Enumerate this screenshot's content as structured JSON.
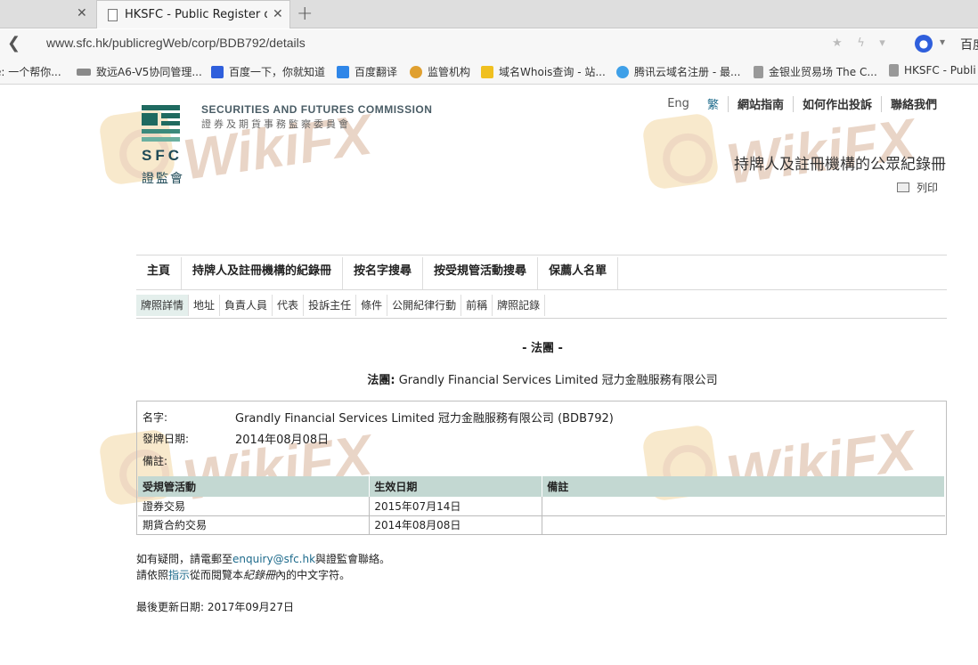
{
  "browser": {
    "tabs": [
      {
        "title": "",
        "active": false
      },
      {
        "title": "HKSFC - Public Register of L",
        "active": true
      }
    ],
    "url": "www.sfc.hk/publicregWeb/corp/BDB792/details",
    "search_engine_label": "百度",
    "bookmarks": [
      {
        "label": "e: 一个帮你...",
        "icon": "blank-icon"
      },
      {
        "label": "致远A6-V5协同管理...",
        "icon": "seeyon-icon"
      },
      {
        "label": "百度一下，你就知道",
        "icon": "baidu-icon"
      },
      {
        "label": "百度翻译",
        "icon": "translate-icon"
      },
      {
        "label": "监管机构",
        "icon": "regulator-icon"
      },
      {
        "label": "域名Whois查询 - 站...",
        "icon": "whois-icon"
      },
      {
        "label": "腾讯云域名注册 - 最...",
        "icon": "tencent-cloud-icon"
      },
      {
        "label": "金银业贸易场 The C...",
        "icon": "page-icon"
      },
      {
        "label": "HKSFC - Publi",
        "icon": "page-icon"
      }
    ]
  },
  "header": {
    "org_en": "SECURITIES AND FUTURES COMMISSION",
    "org_cn": "證券及期貨事務監察委員會",
    "logo_abbr": "SFC",
    "logo_cn": "證監會",
    "top_links": [
      "Eng",
      "繁",
      "網站指南",
      "如何作出投訴",
      "聯絡我們"
    ],
    "register_title": "持牌人及註冊機構的公眾紀錄冊",
    "print_label": "列印"
  },
  "main_nav": [
    "主頁",
    "持牌人及註冊機構的紀錄冊",
    "按名字搜尋",
    "按受規管活動搜尋",
    "保薦人名單"
  ],
  "sub_nav": [
    "牌照詳情",
    "地址",
    "負責人員",
    "代表",
    "投訴主任",
    "條件",
    "公開紀律行動",
    "前稱",
    "牌照記錄"
  ],
  "section_title": "- 法團 -",
  "corp_line": {
    "label": "法團:",
    "value": "Grandly Financial Services Limited 冠力金融服務有限公司"
  },
  "details": {
    "name_label": "名字:",
    "name_value": "Grandly Financial Services Limited 冠力金融服務有限公司 (BDB792)",
    "date_label": "發牌日期:",
    "date_value": "2014年08月08日",
    "remark_label": "備註:",
    "remark_value": ""
  },
  "activities_table": {
    "headers": [
      "受規管活動",
      "生效日期",
      "備註"
    ],
    "rows": [
      [
        "證券交易",
        "2015年07月14日",
        ""
      ],
      [
        "期貨合約交易",
        "2014年08月08日",
        ""
      ]
    ]
  },
  "footer": {
    "enquiry_prefix": "如有疑問，請電郵至",
    "enquiry_email": "enquiry@sfc.hk",
    "enquiry_suffix": "與證監會聯絡。",
    "guide_prefix": "請依照",
    "guide_link": "指示",
    "guide_mid": "從而閱覽本",
    "guide_italic": "紀錄冊",
    "guide_suffix": "內的中文字符。",
    "last_updated_label": "最後更新日期:",
    "last_updated_value": "2017年09月27日"
  },
  "watermark_text": "WikiFX"
}
